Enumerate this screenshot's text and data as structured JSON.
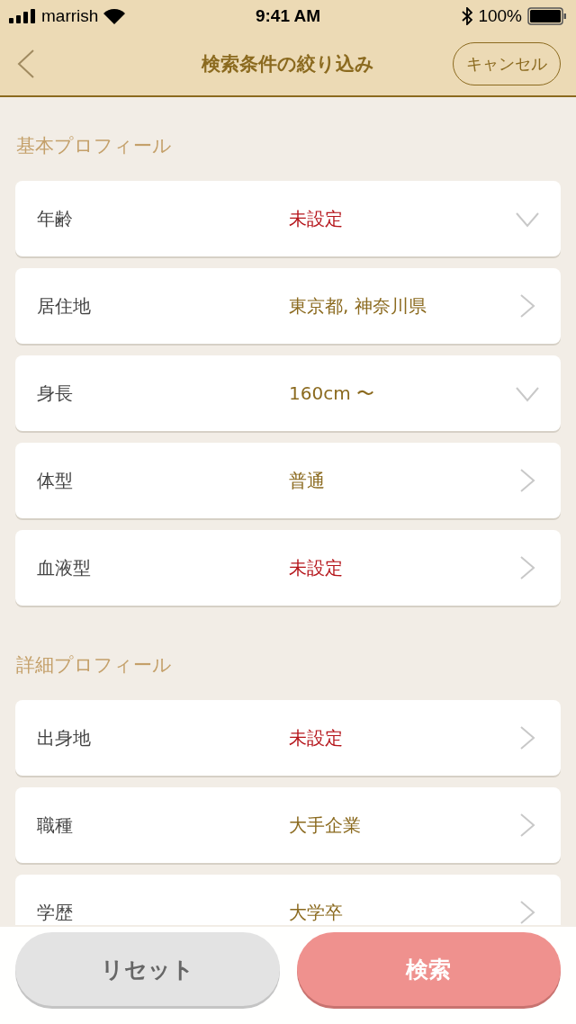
{
  "status_bar": {
    "carrier": "marrish",
    "time": "9:41 AM",
    "battery": "100%"
  },
  "nav": {
    "title": "検索条件の絞り込み",
    "cancel": "キャンセル"
  },
  "sections": [
    {
      "title": "基本プロフィール",
      "rows": [
        {
          "label": "年齢",
          "value": "未設定",
          "is_set": false,
          "kind": "dropdown"
        },
        {
          "label": "居住地",
          "value": "東京都, 神奈川県",
          "is_set": true,
          "kind": "link"
        },
        {
          "label": "身長",
          "value": "160cm 〜",
          "is_set": true,
          "kind": "dropdown"
        },
        {
          "label": "体型",
          "value": "普通",
          "is_set": true,
          "kind": "link"
        },
        {
          "label": "血液型",
          "value": "未設定",
          "is_set": false,
          "kind": "link"
        }
      ]
    },
    {
      "title": "詳細プロフィール",
      "rows": [
        {
          "label": "出身地",
          "value": "未設定",
          "is_set": false,
          "kind": "link"
        },
        {
          "label": "職種",
          "value": "大手企業",
          "is_set": true,
          "kind": "link"
        },
        {
          "label": "学歴",
          "value": "大学卒",
          "is_set": true,
          "kind": "link"
        }
      ]
    }
  ],
  "buttons": [
    {
      "label": "リセット",
      "kind": "secondary"
    },
    {
      "label": "検索",
      "kind": "primary"
    }
  ]
}
